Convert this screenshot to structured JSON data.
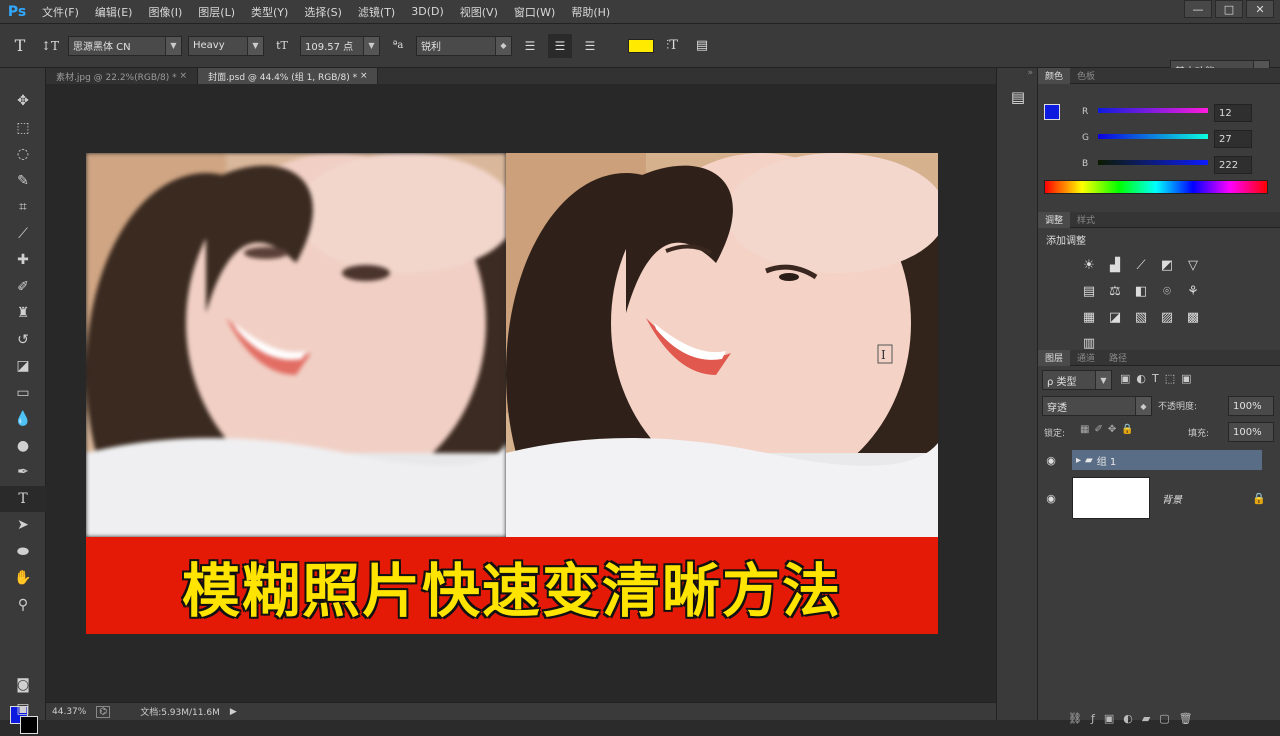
{
  "app": {
    "logo": "Ps"
  },
  "menu": [
    "文件(F)",
    "编辑(E)",
    "图像(I)",
    "图层(L)",
    "类型(Y)",
    "选择(S)",
    "滤镜(T)",
    "3D(D)",
    "视图(V)",
    "窗口(W)",
    "帮助(H)"
  ],
  "window_buttons": [
    "—",
    "□",
    "✕"
  ],
  "options": {
    "font_family": "思源黑体 CN",
    "font_style": "Heavy",
    "font_size": "109.57 点",
    "antialias": "锐利",
    "text_color": "#ffea00",
    "workspace": "基本功能"
  },
  "tabs": [
    {
      "label": "素材.jpg @ 22.2%(RGB/8) *",
      "active": false
    },
    {
      "label": "封面.psd @ 44.4% (组 1, RGB/8) *",
      "active": true
    }
  ],
  "document": {
    "banner_text": "模糊照片快速变清晰方法",
    "banner_color": "#e51a06"
  },
  "status": {
    "zoom": "44.37%",
    "doc_size": "文档:5.93M/11.6M"
  },
  "color_panel": {
    "tabs": [
      "颜色",
      "色板"
    ],
    "R": "12",
    "G": "27",
    "B": "222",
    "fg_color": "#0c1bde"
  },
  "adjust_panel": {
    "tabs": [
      "调整",
      "样式"
    ],
    "title": "添加调整"
  },
  "layers_panel": {
    "tabs": [
      "图层",
      "通道",
      "路径"
    ],
    "filter": "ρ 类型",
    "blend_mode": "穿透",
    "opacity_label": "不透明度:",
    "opacity": "100%",
    "lock_label": "锁定:",
    "fill_label": "填充:",
    "fill": "100%",
    "layers": [
      {
        "name": "组 1",
        "type": "group",
        "selected": true
      },
      {
        "name": "背景",
        "type": "background",
        "selected": false
      }
    ]
  },
  "icons": [
    "type-tool-icon",
    "eye-icon",
    "lock-icon",
    "folder-icon"
  ]
}
